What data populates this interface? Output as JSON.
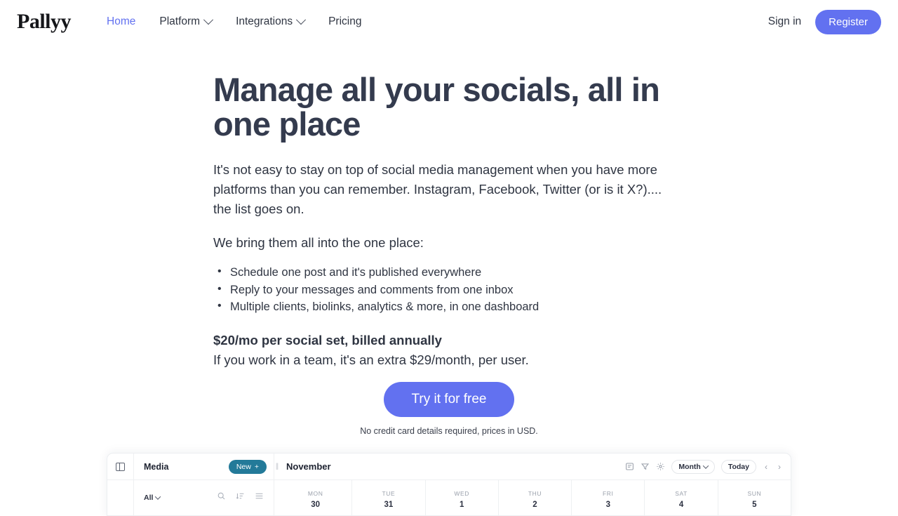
{
  "brand": {
    "logo_text": "Pallyy"
  },
  "nav": {
    "items": [
      {
        "label": "Home",
        "active": true,
        "has_chevron": false
      },
      {
        "label": "Platform",
        "active": false,
        "has_chevron": true
      },
      {
        "label": "Integrations",
        "active": false,
        "has_chevron": true
      },
      {
        "label": "Pricing",
        "active": false,
        "has_chevron": false
      }
    ],
    "signin_label": "Sign in",
    "register_label": "Register"
  },
  "hero": {
    "heading": "Manage all your socials, all in one place",
    "paragraph": "It's not easy to stay on top of social media management when you have more platforms than you can remember. Instagram, Facebook, Twitter (or is it X?).... the list goes on.",
    "lead": "We bring them all into the one place:",
    "bullets": [
      "Schedule one post and it's published everywhere",
      "Reply to your messages and comments from one inbox",
      "Multiple clients, biolinks, analytics & more, in one dashboard"
    ],
    "price_headline": "$20/mo per social set, billed annually",
    "price_sub": "If you work in a team, it's an extra $29/month, per user.",
    "cta_label": "Try it for free",
    "cta_note": "No credit card details required, prices in USD."
  },
  "app_preview": {
    "sidebar_toggle_icon": "panel-toggle-icon",
    "media_panel": {
      "title": "Media",
      "new_button_label": "New",
      "new_button_icon": "plus-icon",
      "filter_label": "All",
      "tool_icons": [
        "search-icon",
        "sort-icon",
        "list-view-icon"
      ]
    },
    "calendar": {
      "title": "November",
      "tool_icons": [
        "notes-icon",
        "filter-icon",
        "settings-icon"
      ],
      "view_selector": "Month",
      "today_label": "Today",
      "prev_icon": "chevron-left-icon",
      "next_icon": "chevron-right-icon",
      "days": [
        {
          "dow": "MON",
          "num": "30"
        },
        {
          "dow": "TUE",
          "num": "31"
        },
        {
          "dow": "WED",
          "num": "1"
        },
        {
          "dow": "THU",
          "num": "2"
        },
        {
          "dow": "FRI",
          "num": "3"
        },
        {
          "dow": "SAT",
          "num": "4"
        },
        {
          "dow": "SUN",
          "num": "5"
        }
      ]
    }
  },
  "colors": {
    "accent_blue": "#6271f0",
    "heading_navy": "#343b4e",
    "body_text": "#2f3542",
    "new_button_teal": "#237a99"
  }
}
